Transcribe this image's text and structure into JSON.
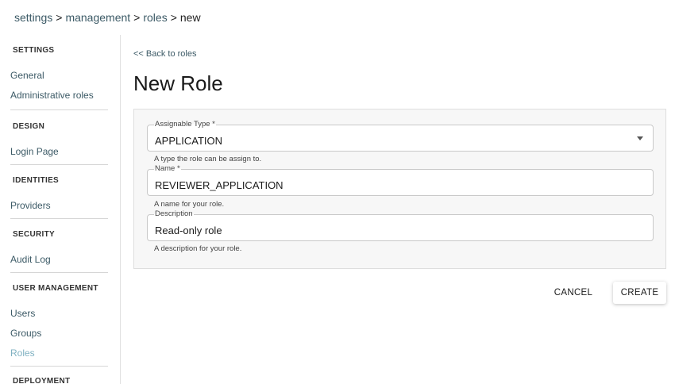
{
  "breadcrumb": {
    "items": [
      "settings",
      "management",
      "roles",
      "new"
    ],
    "separator": ">"
  },
  "sidebar": {
    "sections": [
      {
        "heading": "SETTINGS",
        "items": [
          "General",
          "Administrative roles"
        ]
      },
      {
        "heading": "DESIGN",
        "items": [
          "Login Page"
        ]
      },
      {
        "heading": "IDENTITIES",
        "items": [
          "Providers"
        ]
      },
      {
        "heading": "SECURITY",
        "items": [
          "Audit Log"
        ]
      },
      {
        "heading": "USER MANAGEMENT",
        "items": [
          "Users",
          "Groups",
          "Roles"
        ]
      },
      {
        "heading": "DEPLOYMENT",
        "items": []
      }
    ],
    "active_item": "Roles",
    "active_color": "#7fb1c1"
  },
  "main": {
    "back_link": "<< Back to roles",
    "title": "New Role",
    "form": {
      "assignable_type": {
        "label": "Assignable Type *",
        "value": "APPLICATION",
        "helper": "A type the role can be assign to."
      },
      "name": {
        "label": "Name *",
        "value": "REVIEWER_APPLICATION",
        "helper": "A name for your role."
      },
      "description": {
        "label": "Description",
        "value": "Read-only role",
        "helper": "A description for your role."
      }
    },
    "actions": {
      "cancel": "CANCEL",
      "create": "CREATE"
    }
  },
  "colors": {
    "link": "#3c5a66",
    "panel_bg": "#f7f7f7"
  },
  "icons": {
    "dropdown": "chevron-down-icon"
  }
}
